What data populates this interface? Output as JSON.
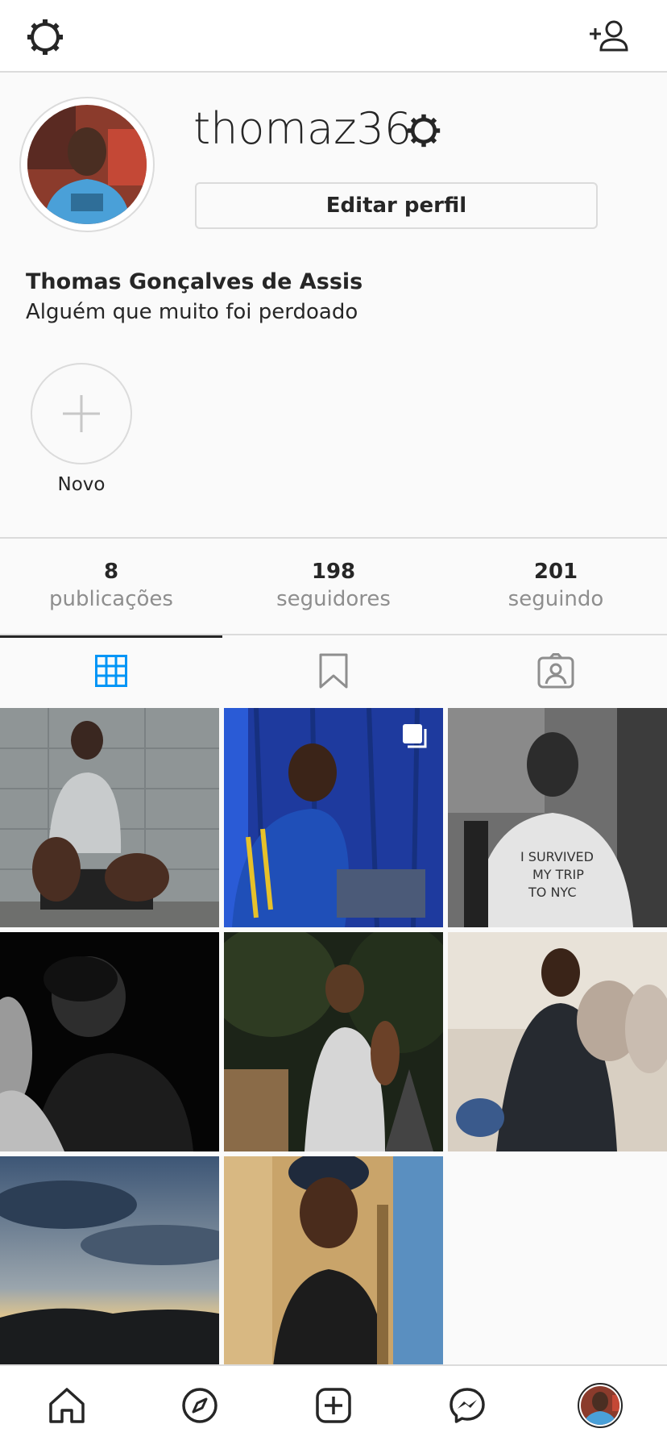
{
  "profile": {
    "username": "thomaz36",
    "edit_label": "Editar perfil",
    "full_name": "Thomas Gonçalves de Assis",
    "bio": "Alguém que muito foi perdoado"
  },
  "highlight": {
    "label": "Novo"
  },
  "stats": [
    {
      "value": "8",
      "label": "publicações"
    },
    {
      "value": "198",
      "label": "seguidores"
    },
    {
      "value": "201",
      "label": "seguindo"
    }
  ],
  "tabs": [
    {
      "icon": "grid-icon",
      "active": true
    },
    {
      "icon": "bookmark-icon",
      "active": false
    },
    {
      "icon": "tagged-icon",
      "active": false
    }
  ],
  "colors": {
    "accent": "#0095f6",
    "border": "#dbdbdb",
    "text": "#262626",
    "muted": "#8e8e8e"
  },
  "posts": [
    {
      "description": "man sitting against tiled wall",
      "multi": false
    },
    {
      "description": "man smiling in front of blue curtain",
      "multi": true
    },
    {
      "description": "black and white selfie with I survived my trip to NYC shirt",
      "multi": false
    },
    {
      "description": "black and white portrait looking down",
      "multi": false
    },
    {
      "description": "man smiling in forest",
      "multi": false
    },
    {
      "description": "man holding silver balloons",
      "multi": false
    },
    {
      "description": "sunset sky over city",
      "multi": false
    },
    {
      "description": "man wearing cap in sunlight",
      "multi": false
    }
  ],
  "nav": [
    "home-icon",
    "explore-icon",
    "new-post-icon",
    "messenger-icon",
    "profile-avatar"
  ]
}
